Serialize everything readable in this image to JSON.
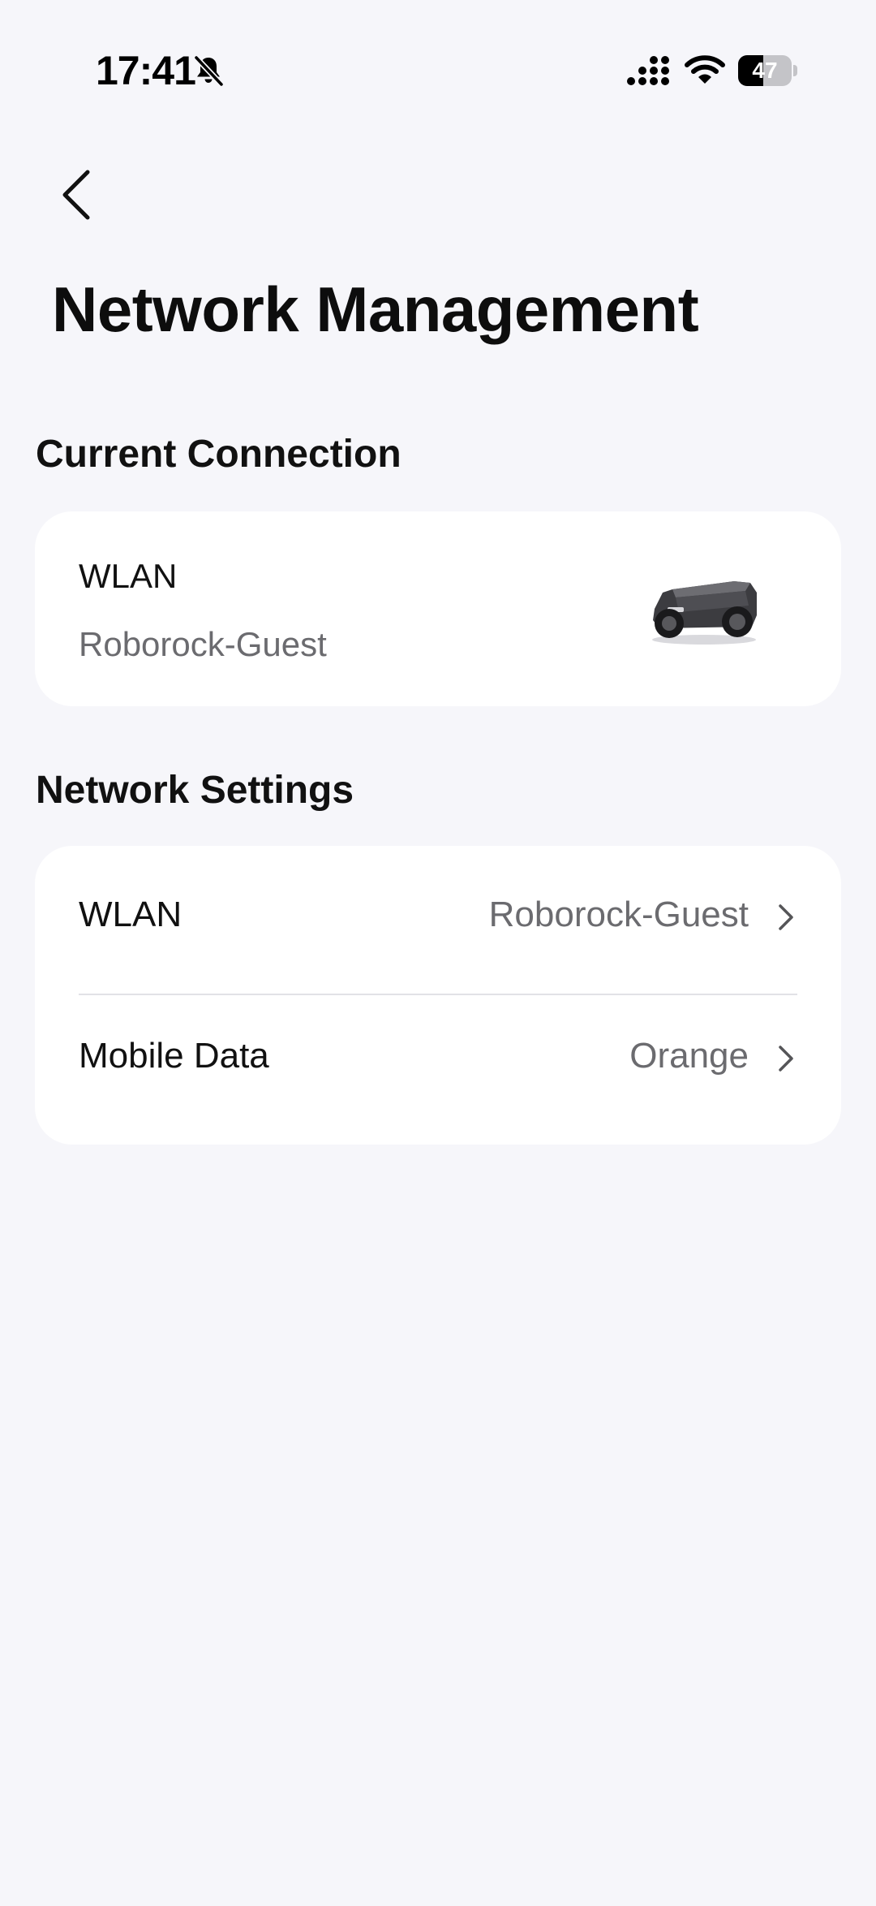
{
  "status_bar": {
    "time": "17:41",
    "battery_level": "47",
    "battery_fraction": 0.47
  },
  "header": {
    "back_icon": "chevron-left-icon",
    "title": "Network Management"
  },
  "current_connection": {
    "section_title": "Current Connection",
    "label": "WLAN",
    "value": "Roborock-Guest",
    "device_image": "robot-mower-image"
  },
  "network_settings": {
    "section_title": "Network Settings",
    "items": [
      {
        "label": "WLAN",
        "value": "Roborock-Guest"
      },
      {
        "label": "Mobile Data",
        "value": "Orange"
      }
    ]
  },
  "colors": {
    "background": "#f6f6fa",
    "card": "#ffffff",
    "primary_text": "#111111",
    "secondary_text": "#6b6b6f",
    "divider": "#e2e2e6"
  }
}
